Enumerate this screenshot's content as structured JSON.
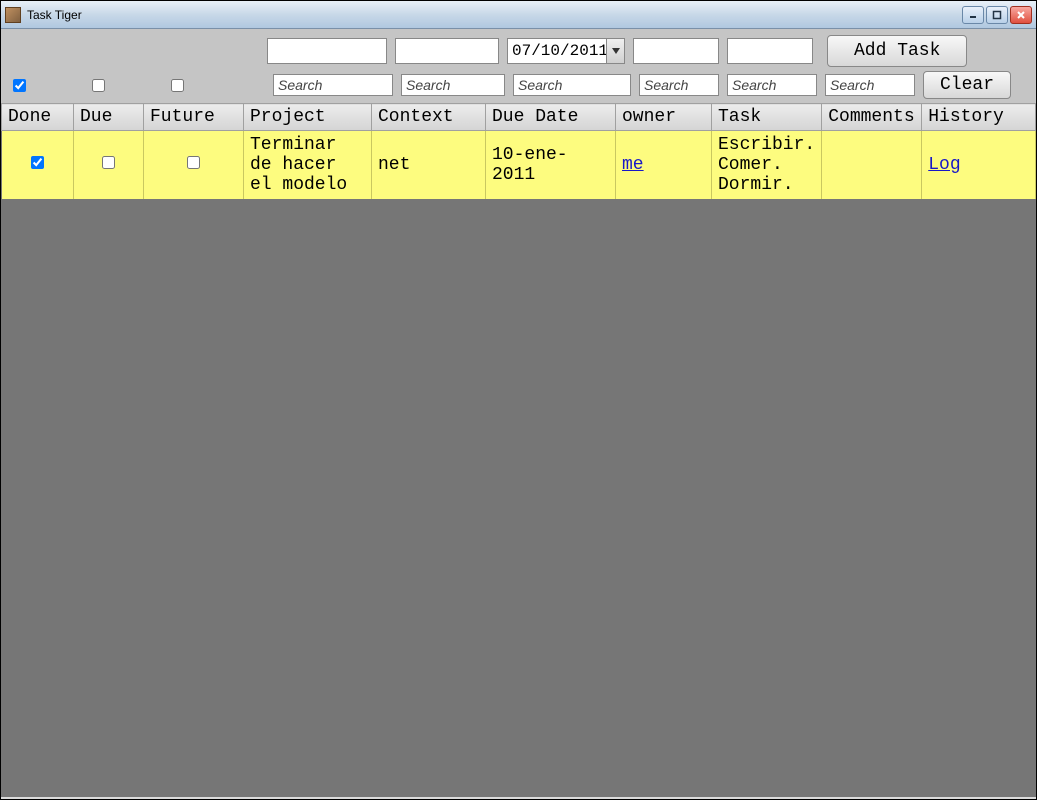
{
  "window": {
    "title": "Task Tiger"
  },
  "toolbar": {
    "checkboxes": {
      "done": true,
      "due": false,
      "future": false
    },
    "inputs": {
      "project": "",
      "context": "",
      "due_date": "07/10/2011",
      "owner": "",
      "task": ""
    },
    "add_task_label": "Add Task",
    "clear_label": "Clear",
    "search_placeholder": "Search"
  },
  "columns": {
    "done": "Done",
    "due": "Due",
    "future": "Future",
    "project": "Project",
    "context": "Context",
    "due_date": "Due Date",
    "owner": "owner",
    "task": "Task",
    "comments": "Comments",
    "history": "History"
  },
  "rows": [
    {
      "done": true,
      "due": false,
      "future": false,
      "project": "Terminar de hacer el modelo",
      "context": "net",
      "due_date": "10-ene-2011",
      "owner": "me",
      "task": "Escribir. Comer. Dormir.",
      "comments": "",
      "history": "Log"
    }
  ]
}
